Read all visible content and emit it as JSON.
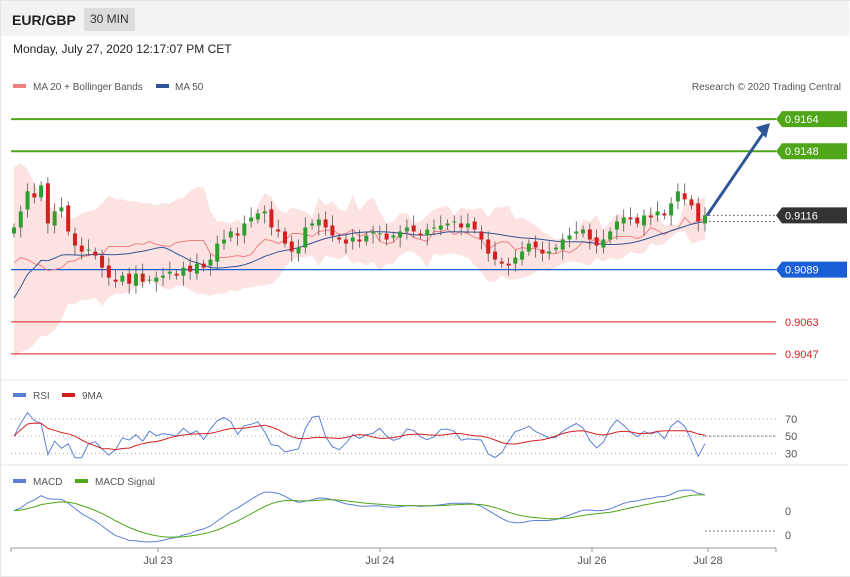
{
  "header": {
    "pair": "EUR/GBP",
    "timeframe": "30 MIN",
    "datetime": "Monday, July 27, 2020 12:17:07 PM CET"
  },
  "legend": {
    "ma20": "MA 20 + Bollinger Bands",
    "ma50": "MA 50",
    "credit": "Research © 2020 Trading Central",
    "rsi": "RSI",
    "rsi_ma": "9MA",
    "macd": "MACD",
    "macd_signal": "MACD Signal"
  },
  "colors": {
    "ma20": "#f08080",
    "ma50": "#2f5597",
    "band_fill": "#fde2e2",
    "bull": "#2e9e2e",
    "bear": "#d41f1f",
    "resistance": "#4fa619",
    "support_strong": "#1a5fd6",
    "support_weak": "#d41f1f",
    "current": "#333333",
    "arrow": "#2f5597",
    "rsi": "#5b7fd6",
    "macd": "#5b7fd6",
    "signal": "#4fa619"
  },
  "chart_data": [
    {
      "type": "candlestick",
      "title": "EUR/GBP 30 MIN",
      "x_ticks": [
        "Jul 23",
        "Jul 24",
        "Jul 26",
        "Jul 28"
      ],
      "ylim": [
        9038,
        9176
      ],
      "levels": [
        {
          "label": "0.9164",
          "value": 9164,
          "kind": "resistance"
        },
        {
          "label": "0.9148",
          "value": 9148,
          "kind": "resistance"
        },
        {
          "label": "0.9116",
          "value": 9116,
          "kind": "current"
        },
        {
          "label": "0.9089",
          "value": 9089,
          "kind": "support_strong"
        },
        {
          "label": "0.9063",
          "value": 9063,
          "kind": "support_weak"
        },
        {
          "label": "0.9047",
          "value": 9047,
          "kind": "support_weak"
        }
      ],
      "close": [
        9110,
        9118,
        9128,
        9125,
        9131,
        9112,
        9118,
        9120,
        9108,
        9101,
        9098,
        9099,
        9096,
        9090,
        9085,
        9083,
        9086,
        9082,
        9087,
        9083,
        9084,
        9085,
        9086,
        9088,
        9086,
        9090,
        9088,
        9092,
        9090,
        9094,
        9102,
        9104,
        9108,
        9106,
        9112,
        9115,
        9117,
        9118,
        9110,
        9108,
        9102,
        9098,
        9100,
        9110,
        9112,
        9114,
        9110,
        9106,
        9104,
        9102,
        9105,
        9103,
        9106,
        9108,
        9107,
        9104,
        9106,
        9108,
        9110,
        9108,
        9106,
        9109,
        9110,
        9111,
        9112,
        9113,
        9110,
        9112,
        9109,
        9104,
        9097,
        9094,
        9092,
        9091,
        9095,
        9098,
        9102,
        9100,
        9097,
        9098,
        9100,
        9104,
        9106,
        9108,
        9109,
        9104,
        9101,
        9104,
        9108,
        9113,
        9115,
        9114,
        9112,
        9116,
        9115,
        9118,
        9116,
        9122,
        9128,
        9124,
        9121,
        9113,
        9116
      ],
      "bollinger_upper": [
        9140,
        9142,
        9139,
        9132,
        9126,
        9121,
        9119,
        9116,
        9114,
        9115,
        9117,
        9118,
        9119,
        9122,
        9126,
        9124,
        9124,
        9123,
        9123,
        9122,
        9122,
        9121,
        9122,
        9122,
        9124,
        9125,
        9128,
        9130,
        9130,
        9118,
        9113,
        9113,
        9112,
        9114,
        9111,
        9113,
        9121,
        9127,
        9125,
        9119,
        9117,
        9120,
        9119,
        9118,
        9115,
        9125,
        9121,
        9123,
        9119,
        9118,
        9126,
        9118,
        9123,
        9125,
        9118,
        9112,
        9113,
        9117,
        9117,
        9112,
        9113,
        9116,
        9119,
        9120,
        9121,
        9116,
        9120,
        9119,
        9119,
        9120,
        9115,
        9120,
        9120,
        9121,
        9114,
        9115,
        9113,
        9111,
        9108,
        9106,
        9104,
        9105,
        9102,
        9106,
        9114,
        9113,
        9116,
        9109,
        9113,
        9117,
        9116,
        9113,
        9112,
        9115,
        9118,
        9116,
        9111,
        9112,
        9111,
        9122,
        9121,
        9124,
        9125
      ],
      "bollinger_lower": [
        9045,
        9048,
        9049,
        9052,
        9056,
        9056,
        9059,
        9064,
        9072,
        9072,
        9074,
        9074,
        9075,
        9071,
        9075,
        9077,
        9077,
        9078,
        9081,
        9081,
        9084,
        9082,
        9080,
        9079,
        9081,
        9081,
        9079,
        9077,
        9077,
        9076,
        9077,
        9077,
        9079,
        9078,
        9080,
        9080,
        9081,
        9081,
        9082,
        9085,
        9090,
        9094,
        9095,
        9095,
        9096,
        9091,
        9096,
        9095,
        9094,
        9096,
        9092,
        9093,
        9091,
        9093,
        9088,
        9092,
        9092,
        9096,
        9098,
        9098,
        9095,
        9090,
        9097,
        9096,
        9097,
        9097,
        9096,
        9095,
        9091,
        9088,
        9083,
        9083,
        9086,
        9084,
        9084,
        9085,
        9086,
        9088,
        9089,
        9088,
        9090,
        9092,
        9093,
        9093,
        9092,
        9091,
        9095,
        9093,
        9095,
        9094,
        9095,
        9098,
        9097,
        9097,
        9102,
        9101,
        9102,
        9105,
        9108,
        9108,
        9102,
        9103,
        9104
      ],
      "rsi_ticks": [
        70,
        50,
        30
      ],
      "macd_ticks": [
        "0",
        "0"
      ]
    }
  ]
}
